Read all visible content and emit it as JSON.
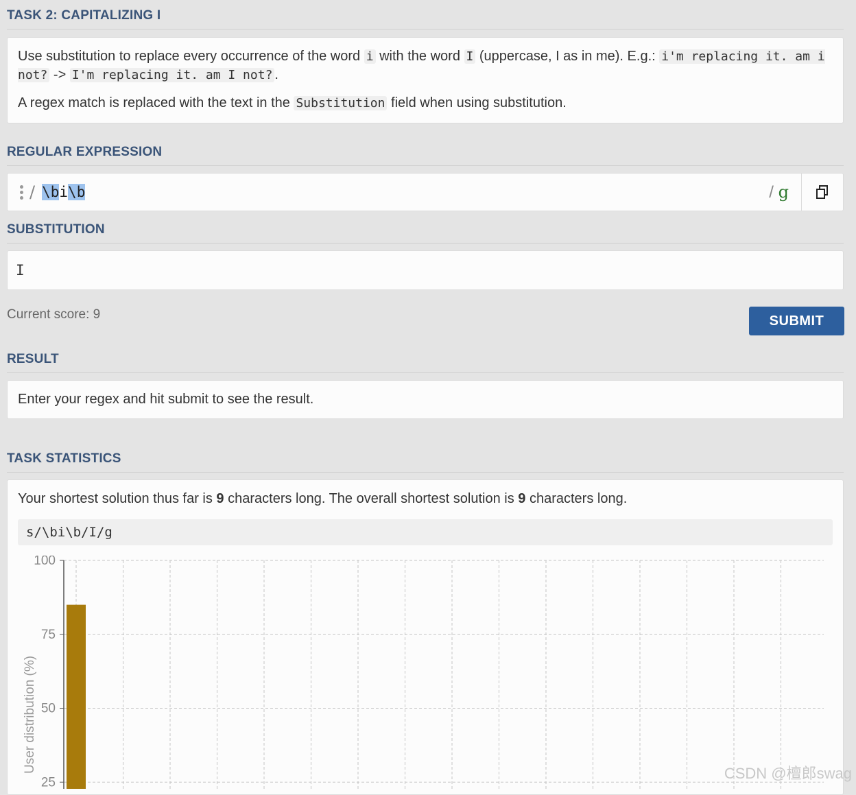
{
  "task": {
    "title": "TASK 2: CAPITALIZING I",
    "desc_1a": "Use substitution to replace every occurrence of the word ",
    "code_i": "i",
    "desc_1b": " with the word ",
    "code_I": "I",
    "desc_1c": " (uppercase, I as in me). E.g.: ",
    "example_in": "i'm replacing it. am i not?",
    "arrow": " -> ",
    "example_out": "I'm replacing it. am I not?",
    "period": ".",
    "desc_2a": "A regex match is replaced with the text in the ",
    "code_subst": "Substitution",
    "desc_2b": " field when using substitution."
  },
  "regex": {
    "title": "REGULAR EXPRESSION",
    "delimiter": "/",
    "part_1": "\\b",
    "part_2": "i",
    "part_3": "\\b",
    "flags_slash": "/ ",
    "flags": "g"
  },
  "substitution": {
    "title": "SUBSTITUTION",
    "value": "I"
  },
  "score": {
    "label": "Current score: 9"
  },
  "submit": {
    "label": "SUBMIT"
  },
  "result": {
    "title": "RESULT",
    "text": "Enter your regex and hit submit to see the result."
  },
  "stats": {
    "title": "TASK STATISTICS",
    "text_a": "Your shortest solution thus far is ",
    "yours": "9",
    "text_b": " characters long. The overall shortest solution is ",
    "overall": "9",
    "text_c": " characters long.",
    "solution": "s/\\bi\\b/I/g"
  },
  "chart_data": {
    "type": "bar",
    "ylabel": "User distribution (%)",
    "yticks": [
      25,
      50,
      75,
      100
    ],
    "ylim": [
      25,
      100
    ],
    "grid": true,
    "columns": 16,
    "bar_color": "#a87b0c",
    "values": [
      85
    ]
  },
  "watermark": "CSDN @檀郎swag"
}
